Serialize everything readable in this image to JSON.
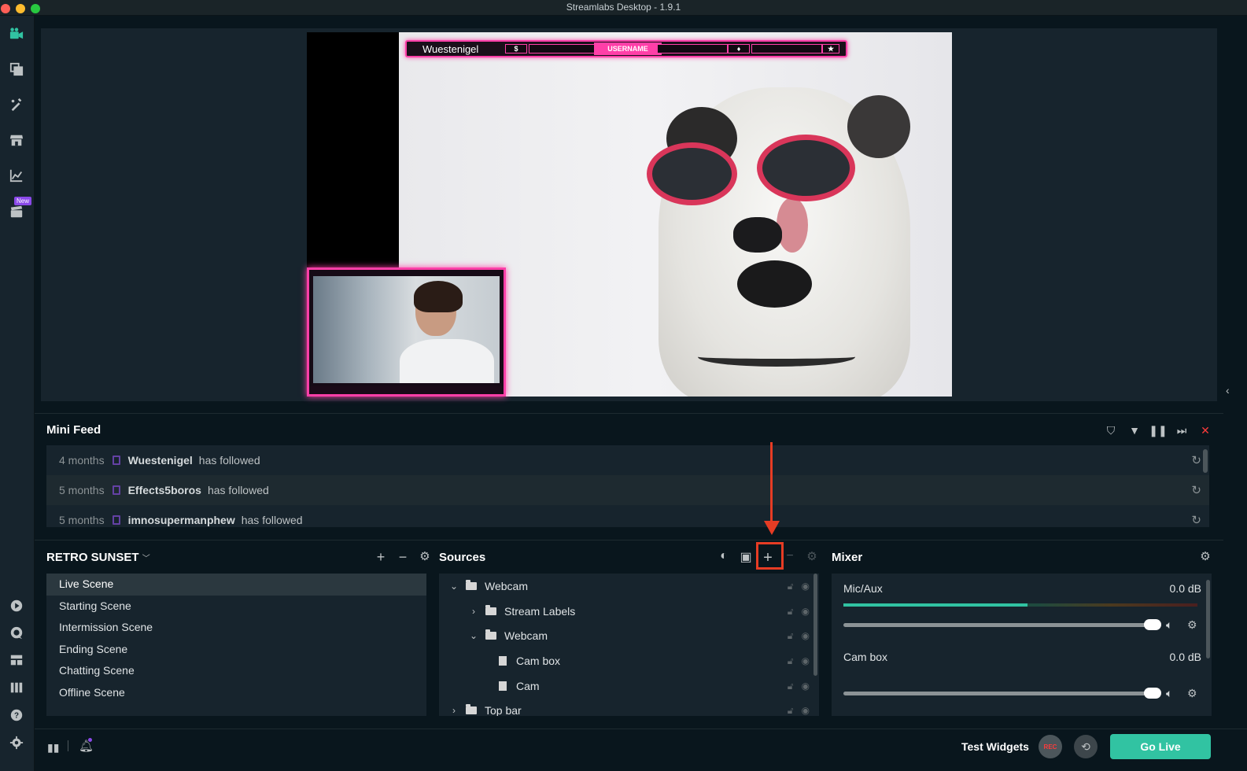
{
  "window": {
    "title": "Streamlabs Desktop - 1.9.1"
  },
  "nav": {
    "new_badge": "New",
    "items": [
      "studio-icon",
      "themes-icon",
      "editor-icon",
      "store-icon",
      "analytics-icon",
      "highlighter-icon",
      "prime-icon",
      "help-icon",
      "layout-icon",
      "columns-icon",
      "question-icon",
      "settings-icon"
    ]
  },
  "preview": {
    "overlay": {
      "username": "Wuestenigel",
      "center_label": "USERNAME",
      "seg_dollar": "$",
      "seg_diamond": "♦",
      "seg_star": "★"
    }
  },
  "minifeed": {
    "title": "Mini Feed",
    "events": [
      {
        "time": "4 months",
        "name": "Wuestenigel",
        "action": "has followed"
      },
      {
        "time": "5 months",
        "name": "Effects5boros",
        "action": "has followed"
      },
      {
        "time": "5 months",
        "name": "imnosupermanphew",
        "action": "has followed"
      }
    ]
  },
  "scenes": {
    "title": "RETRO SUNSET",
    "items": [
      "Live Scene",
      "Starting Scene",
      "Intermission Scene",
      "Ending Scene",
      "Chatting Scene",
      "Offline Scene"
    ],
    "selected": "Live Scene"
  },
  "sources": {
    "title": "Sources",
    "items": [
      {
        "label": "Webcam",
        "kind": "folder",
        "expanded": true
      },
      {
        "label": "Stream Labels",
        "kind": "folder",
        "expanded": false
      },
      {
        "label": "Webcam",
        "kind": "folder",
        "expanded": true
      },
      {
        "label": "Cam box",
        "kind": "file"
      },
      {
        "label": "Cam",
        "kind": "file"
      },
      {
        "label": "Top bar",
        "kind": "folder",
        "expanded": false
      }
    ]
  },
  "mixer": {
    "title": "Mixer",
    "channels": [
      {
        "name": "Mic/Aux",
        "db": "0.0 dB",
        "level": 0.52
      },
      {
        "name": "Cam box",
        "db": "0.0 dB",
        "level": 0
      }
    ]
  },
  "footer": {
    "test_widgets": "Test Widgets",
    "rec": "REC",
    "go_live": "Go Live"
  },
  "colors": {
    "accent": "#31c3a2",
    "overlay_pink": "#ff3fa8",
    "annotation": "#e63c24",
    "twitch": "#6441a4"
  }
}
